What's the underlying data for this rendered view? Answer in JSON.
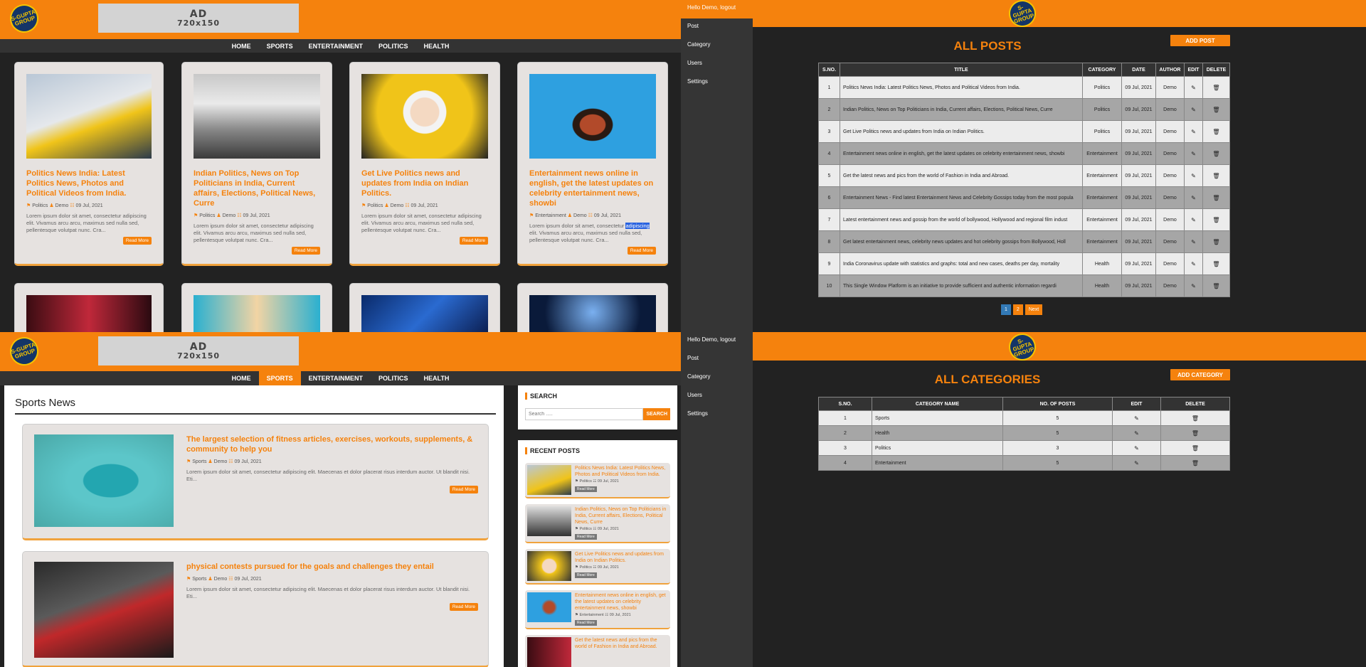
{
  "site": {
    "logo_text": "S-GUPTA GROUP",
    "ad_title": "AD",
    "ad_size": "720x150",
    "nav": [
      "HOME",
      "SPORTS",
      "ENTERTAINMENT",
      "POLITICS",
      "HEALTH"
    ]
  },
  "home": {
    "cards": [
      {
        "title": "Politics News India: Latest Politics News, Photos and Political Videos from India.",
        "category": "Politics",
        "author": "Demo",
        "date": "09 Jul, 2021",
        "excerpt": "Lorem ipsum dolor sit amet, consectetur adipiscing elit. Vivamus arcu arcu, maximus sed nulla sed, pellentesque volutpat nunc. Cra...",
        "btn": "Read More"
      },
      {
        "title": "Indian Politics, News on Top Politicians in India, Current affairs, Elections, Political News, Curre",
        "category": "Politics",
        "author": "Demo",
        "date": "09 Jul, 2021",
        "excerpt": "Lorem ipsum dolor sit amet, consectetur adipiscing elit. Vivamus arcu arcu, maximus sed nulla sed, pellentesque volutpat nunc. Cra...",
        "btn": "Read More"
      },
      {
        "title": "Get Live Politics news and updates from India on Indian Politics.",
        "category": "Politics",
        "author": "Demo",
        "date": "09 Jul, 2021",
        "excerpt": "Lorem ipsum dolor sit amet, consectetur adipiscing elit. Vivamus arcu arcu, maximus sed nulla sed, pellentesque volutpat nunc. Cra...",
        "btn": "Read More"
      },
      {
        "title": "Entertainment news online in english, get the latest updates on celebrity entertainment news, showbi",
        "category": "Entertainment",
        "author": "Demo",
        "date": "09 Jul, 2021",
        "excerpt_a": "Lorem ipsum dolor sit amet, consectetur ",
        "excerpt_hl": "adipiscing",
        "excerpt_b": " elit. Vivamus arcu arcu, maximus sed nulla sed, pellentesque volutpat nunc. Cra...",
        "btn": "Read More"
      }
    ]
  },
  "admin": {
    "hello": "Hello Demo, logout",
    "menu": [
      "Post",
      "Category",
      "Users",
      "Settings"
    ],
    "posts_title": "ALL POSTS",
    "add_post": "ADD POST",
    "post_headers": [
      "S.NO.",
      "TITLE",
      "CATEGORY",
      "DATE",
      "AUTHOR",
      "EDIT",
      "DELETE"
    ],
    "posts": [
      {
        "n": "1",
        "title": "Politics News India: Latest Politics News, Photos and Political Videos from India.",
        "cat": "Politics",
        "date": "09 Jul, 2021",
        "author": "Demo"
      },
      {
        "n": "2",
        "title": "Indian Politics, News on Top Politicians in India, Current affairs, Elections, Political News, Curre",
        "cat": "Politics",
        "date": "09 Jul, 2021",
        "author": "Demo"
      },
      {
        "n": "3",
        "title": "Get Live Politics news and updates from India on Indian Politics.",
        "cat": "Politics",
        "date": "09 Jul, 2021",
        "author": "Demo"
      },
      {
        "n": "4",
        "title": "Entertainment news online in english, get the latest updates on celebrity entertainment news, showbi",
        "cat": "Entertainment",
        "date": "09 Jul, 2021",
        "author": "Demo"
      },
      {
        "n": "5",
        "title": "Get the latest news and pics from the world of Fashion in India and Abroad.",
        "cat": "Entertainment",
        "date": "09 Jul, 2021",
        "author": "Demo"
      },
      {
        "n": "6",
        "title": "Entertainment News - Find latest Entertainment News and Celebrity Gossips today from the most popula",
        "cat": "Entertainment",
        "date": "09 Jul, 2021",
        "author": "Demo"
      },
      {
        "n": "7",
        "title": "Latest entertainment news and gossip from the world of bollywood, Hollywood and regional film indust",
        "cat": "Entertainment",
        "date": "09 Jul, 2021",
        "author": "Demo"
      },
      {
        "n": "8",
        "title": "Get latest entertainment news, celebrity news updates and hot celebrity gossips from Bollywood, Holl",
        "cat": "Entertainment",
        "date": "09 Jul, 2021",
        "author": "Demo"
      },
      {
        "n": "9",
        "title": "India Coronavirus update with statistics and graphs: total and new cases, deaths per day, mortality",
        "cat": "Health",
        "date": "09 Jul, 2021",
        "author": "Demo"
      },
      {
        "n": "10",
        "title": "This Single Window Platform is an initiative to provide sufficient and authentic information regardi",
        "cat": "Health",
        "date": "09 Jul, 2021",
        "author": "Demo"
      }
    ],
    "pagination": [
      "1",
      "2",
      "Next"
    ],
    "cat_title": "ALL CATEGORIES",
    "add_cat": "ADD CATEGORY",
    "cat_headers": [
      "S.NO.",
      "CATEGORY NAME",
      "NO. OF POSTS",
      "EDIT",
      "DELETE"
    ],
    "cats": [
      {
        "n": "1",
        "name": "Sports",
        "count": "5"
      },
      {
        "n": "2",
        "name": "Health",
        "count": "5"
      },
      {
        "n": "3",
        "name": "Politics",
        "count": "3"
      },
      {
        "n": "4",
        "name": "Entertainment",
        "count": "5"
      }
    ]
  },
  "sports": {
    "heading": "Sports News",
    "posts": [
      {
        "title": "The largest selection of fitness articles, exercises, workouts, supplements, & community to help you",
        "category": "Sports",
        "author": "Demo",
        "date": "09 Jul, 2021",
        "excerpt": "Lorem ipsum dolor sit amet, consectetur adipiscing elit. Maecenas et dolor placerat risus interdum auctor. Ut blandit nisi. Eti...",
        "btn": "Read More"
      },
      {
        "title": "physical contests pursued for the goals and challenges they entail",
        "category": "Sports",
        "author": "Demo",
        "date": "09 Jul, 2021",
        "excerpt": "Lorem ipsum dolor sit amet, consectetur adipiscing elit. Maecenas et dolor placerat risus interdum auctor. Ut blandit nisi. Eti...",
        "btn": "Read More"
      }
    ],
    "search_title": "SEARCH",
    "search_placeholder": "Search .....",
    "search_btn": "SEARCH",
    "recent_title": "RECENT POSTS",
    "recent": [
      {
        "title": "Politics News India: Latest Politics News, Photos and Political Videos from India.",
        "category": "Politics",
        "date": "09 Jul, 2021"
      },
      {
        "title": "Indian Politics, News on Top Politicians in India, Current affairs, Elections, Political News, Curre",
        "category": "Politics",
        "date": "09 Jul, 2021"
      },
      {
        "title": "Get Live Politics news and updates from India on Indian Politics.",
        "category": "Politics",
        "date": "09 Jul, 2021"
      },
      {
        "title": "Entertainment news online in english, get the latest updates on celebrity entertainment news, showbi",
        "category": "Entertainment",
        "date": "09 Jul, 2021"
      },
      {
        "title": "Get the latest news and pics from the world of Fashion in India and Abroad.",
        "category": "",
        "date": ""
      }
    ],
    "read_more": "Read More"
  }
}
